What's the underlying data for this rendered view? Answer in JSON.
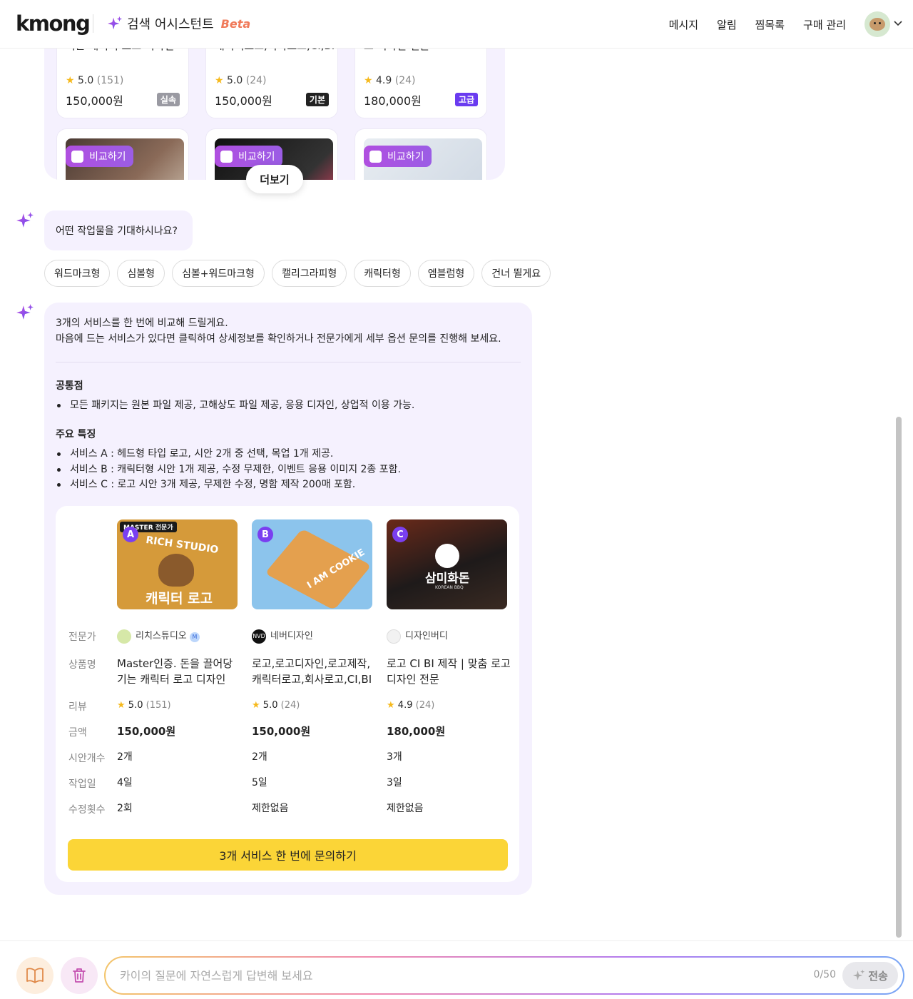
{
  "header": {
    "logo": "kmong",
    "assistant_title": "검색 어시스턴트",
    "beta": "Beta",
    "nav": [
      "메시지",
      "알림",
      "찜목록",
      "구매 관리"
    ]
  },
  "top_cards": [
    {
      "name": "Master인증. 돈을 끌어당기는 캐릭터 로고 디자인",
      "rating": "5.0",
      "count": "(151)",
      "price": "150,000원",
      "badge": "실속",
      "badge_color": "#9a9aa2"
    },
    {
      "name": "로고,로고디자인,로고제작,캐릭터로고,회사로고,CI,BI",
      "rating": "5.0",
      "count": "(24)",
      "price": "150,000원",
      "badge": "기본",
      "badge_color": "#222222"
    },
    {
      "name": "로고 CI BI 제작 | 맞춤 로고 디자인 전문",
      "rating": "4.9",
      "count": "(24)",
      "price": "180,000원",
      "badge": "고급",
      "badge_color": "#6a3bf0"
    }
  ],
  "compare_label": "비교하기",
  "more_label": "더보기",
  "question": "어떤 작업물을 기대하시나요?",
  "chips": [
    "워드마크형",
    "심볼형",
    "심볼+워드마크형",
    "캘리그라피형",
    "캐릭터형",
    "엠블럼형",
    "건너 뛸게요"
  ],
  "answer": {
    "intro_1": "3개의 서비스를 한 번에 비교해 드릴게요.",
    "intro_2": "마음에 드는 서비스가 있다면 클릭하여 상세정보를 확인하거나 전문가에게 세부 옵션 문의를 진행해 보세요.",
    "common_title": "공통점",
    "common": [
      "모든 패키지는 원본 파일 제공, 고해상도 파일 제공, 응용 디자인, 상업적 이용 가능."
    ],
    "features_title": "주요 특징",
    "features": [
      "서비스 A : 헤드형 타입 로고, 시안 2개 중 선택, 목업 1개 제공.",
      "서비스 B : 캐릭터형 시안 1개 제공, 수정 무제한, 이벤트 응용 이미지 2종 포함.",
      "서비스 C : 로고 시안 3개 제공, 무제한 수정, 명함 제작 200매 포함."
    ]
  },
  "table": {
    "labels": [
      "전문가",
      "상품명",
      "리뷰",
      "금액",
      "시안개수",
      "작업일",
      "수정횟수"
    ],
    "columns": [
      {
        "letter": "A",
        "img_text_1": "MASTER 전문가",
        "img_text_2": "RICH STUDIO",
        "img_text_3": "캐릭터 로고",
        "seller": "리치스튜디오",
        "seller_badge": "M",
        "name": "Master인증. 돈을 끌어당기는 캐릭터 로고 디자인",
        "rating": "5.0",
        "count": "(151)",
        "price": "150,000원",
        "drafts": "2개",
        "days": "4일",
        "revisions": "2회"
      },
      {
        "letter": "B",
        "img_text_1": "I AM COOKIE",
        "seller": "네버디자인",
        "seller_short": "NVD",
        "name": "로고,로고디자인,로고제작,캐릭터로고,회사로고,CI,BI",
        "rating": "5.0",
        "count": "(24)",
        "price": "150,000원",
        "drafts": "2개",
        "days": "5일",
        "revisions": "제한없음"
      },
      {
        "letter": "C",
        "img_text_1": "삼미화돈",
        "img_text_2": "KOREAN BBQ",
        "seller": "디자인버디",
        "name": "로고 CI BI 제작 | 맞춤 로고 디자인 전문",
        "rating": "4.9",
        "count": "(24)",
        "price": "180,000원",
        "drafts": "3개",
        "days": "3일",
        "revisions": "제한없음"
      }
    ],
    "cta": "3개 서비스 한 번에 문의하기"
  },
  "footer": {
    "placeholder": "카이의 질문에 자연스럽게 답변해 보세요",
    "counter": "0/50",
    "send": "전송"
  }
}
